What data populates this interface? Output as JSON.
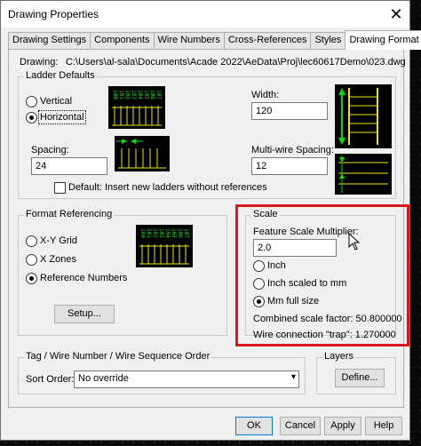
{
  "window": {
    "title": "Drawing Properties",
    "close_glyph": "✕"
  },
  "tabs": [
    {
      "label": "Drawing Settings"
    },
    {
      "label": "Components"
    },
    {
      "label": "Wire Numbers"
    },
    {
      "label": "Cross-References"
    },
    {
      "label": "Styles"
    },
    {
      "label": "Drawing Format"
    }
  ],
  "drawing": {
    "label": "Drawing:",
    "path": "C:\\Users\\al-sala\\Documents\\Acade 2022\\AeData\\Proj\\lec60617Demo\\023.dwg"
  },
  "ladder": {
    "group_title": "Ladder Defaults",
    "vertical_label": "Vertical",
    "horizontal_label": "Horizontal",
    "width_label": "Width:",
    "width_value": "120",
    "spacing_label": "Spacing:",
    "spacing_value": "24",
    "multiwire_label": "Multi-wire Spacing:",
    "multiwire_value": "12",
    "default_label": "Default: Insert new ladders without references",
    "ref_numbers": [
      "100",
      "101",
      "102",
      "103",
      "104",
      "105",
      "106",
      "107"
    ]
  },
  "format_ref": {
    "group_title": "Format Referencing",
    "xy_label": "X-Y Grid",
    "xzones_label": "X Zones",
    "refnum_label": "Reference Numbers",
    "setup_label": "Setup..."
  },
  "scale": {
    "group_title": "Scale",
    "fsm_label": "Feature Scale Multiplier:",
    "fsm_value": "2.0",
    "inch_label": "Inch",
    "inch_mm_label": "Inch scaled to mm",
    "mm_label": "Mm full size",
    "combined_label": "Combined scale factor: 50.800000",
    "trap_label": "Wire connection \"trap\": 1.270000"
  },
  "tag": {
    "group_title": "Tag / Wire Number / Wire Sequence Order",
    "sort_label": "Sort Order:",
    "sort_value": "No override"
  },
  "layers": {
    "group_title": "Layers",
    "define_label": "Define..."
  },
  "footer": {
    "ok": "OK",
    "cancel": "Cancel",
    "apply": "Apply",
    "help": "Help"
  },
  "colors": {
    "highlight": "#d7191f",
    "icon_green": "#00e000",
    "icon_yellow": "#e8e800"
  }
}
